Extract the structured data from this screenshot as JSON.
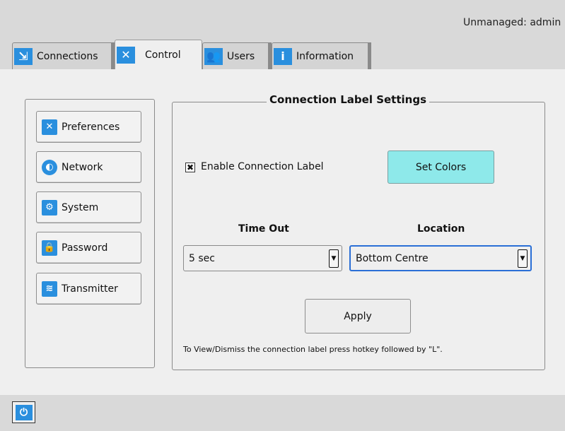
{
  "header": {
    "status_text": "Unmanaged: admin"
  },
  "tabs": [
    {
      "label": "Connections",
      "icon": "connections-icon",
      "active": false
    },
    {
      "label": "Control",
      "icon": "tools-icon",
      "active": true
    },
    {
      "label": "Users",
      "icon": "users-icon",
      "active": false
    },
    {
      "label": "Information",
      "icon": "info-icon",
      "active": false
    }
  ],
  "sidebar": {
    "items": [
      {
        "label": "Preferences",
        "icon": "tools-icon"
      },
      {
        "label": "Network",
        "icon": "network-icon"
      },
      {
        "label": "System",
        "icon": "gear-icon"
      },
      {
        "label": "Password",
        "icon": "lock-icon"
      },
      {
        "label": "Transmitter",
        "icon": "transmitter-icon"
      }
    ]
  },
  "main": {
    "title": "Connection Label Settings",
    "enable_label": "Enable Connection Label",
    "enable_checked": true,
    "set_colors_label": "Set Colors",
    "timeout_label": "Time Out",
    "timeout_value": "5 sec",
    "location_label": "Location",
    "location_value": "Bottom Centre",
    "apply_label": "Apply",
    "hint": "To View/Dismiss the connection label press hotkey followed by \"L\"."
  },
  "colors": {
    "accent": "#2a8fde",
    "set_colors_bg": "#8ee9ea",
    "focus_border": "#2a6fd6",
    "panel_bg": "#efefef",
    "chrome_bg": "#d9d9d9"
  }
}
